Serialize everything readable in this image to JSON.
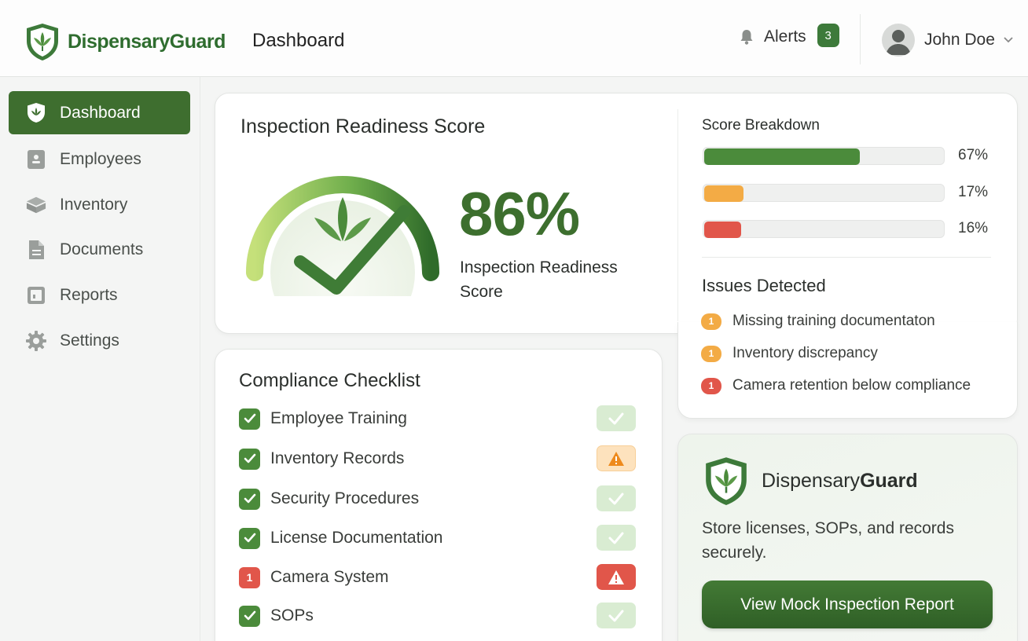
{
  "header": {
    "brand": "DispensaryGuard",
    "page_title": "Dashboard",
    "alerts_label": "Alerts",
    "alerts_count": "3",
    "user_name": "John Doe"
  },
  "sidebar": {
    "items": [
      {
        "label": "Dashboard",
        "icon": "shield-leaf-icon",
        "active": true
      },
      {
        "label": "Employees",
        "icon": "employee-icon",
        "active": false
      },
      {
        "label": "Inventory",
        "icon": "box-icon",
        "active": false
      },
      {
        "label": "Documents",
        "icon": "document-icon",
        "active": false
      },
      {
        "label": "Reports",
        "icon": "report-icon",
        "active": false
      },
      {
        "label": "Settings",
        "icon": "gear-icon",
        "active": false
      }
    ]
  },
  "score": {
    "title": "Inspection Readiness Score",
    "value": "86%",
    "value_fraction": 0.86,
    "label": "Inspection Readiness Score"
  },
  "breakdown": {
    "title": "Score Breakdown",
    "bars": [
      {
        "percent": "67%",
        "fraction": 0.67,
        "color": "#4b8b3b"
      },
      {
        "percent": "17%",
        "fraction": 0.17,
        "color": "#f3ab45"
      },
      {
        "percent": "16%",
        "fraction": 0.16,
        "color": "#e1564a"
      }
    ]
  },
  "issues": {
    "title": "Issues Detected",
    "items": [
      {
        "count": "1",
        "text": "Missing training documentaton",
        "color": "#f3ab45"
      },
      {
        "count": "1",
        "text": "Inventory discrepancy",
        "color": "#f3ab45"
      },
      {
        "count": "1",
        "text": "Camera retention below compliance",
        "color": "#e1564a"
      }
    ]
  },
  "checklist": {
    "title": "Compliance Checklist",
    "items": [
      {
        "label": "Employee Training",
        "status": "ok"
      },
      {
        "label": "Inventory Records",
        "status": "warning"
      },
      {
        "label": "Security Procedures",
        "status": "ok"
      },
      {
        "label": "License Documentation",
        "status": "ok"
      },
      {
        "label": "Camera System",
        "status": "alert",
        "count": "1"
      },
      {
        "label": "SOPs",
        "status": "ok"
      }
    ]
  },
  "promo": {
    "brand_regular": "Dispensary",
    "brand_bold": "Guard",
    "text": "Store licenses, SOPs, and records securely.",
    "button_label": "View Mock Inspection Report"
  },
  "colors": {
    "primary": "#3e6e2f",
    "success": "#4b8b3b",
    "warning": "#f3ab45",
    "danger": "#e1564a"
  }
}
